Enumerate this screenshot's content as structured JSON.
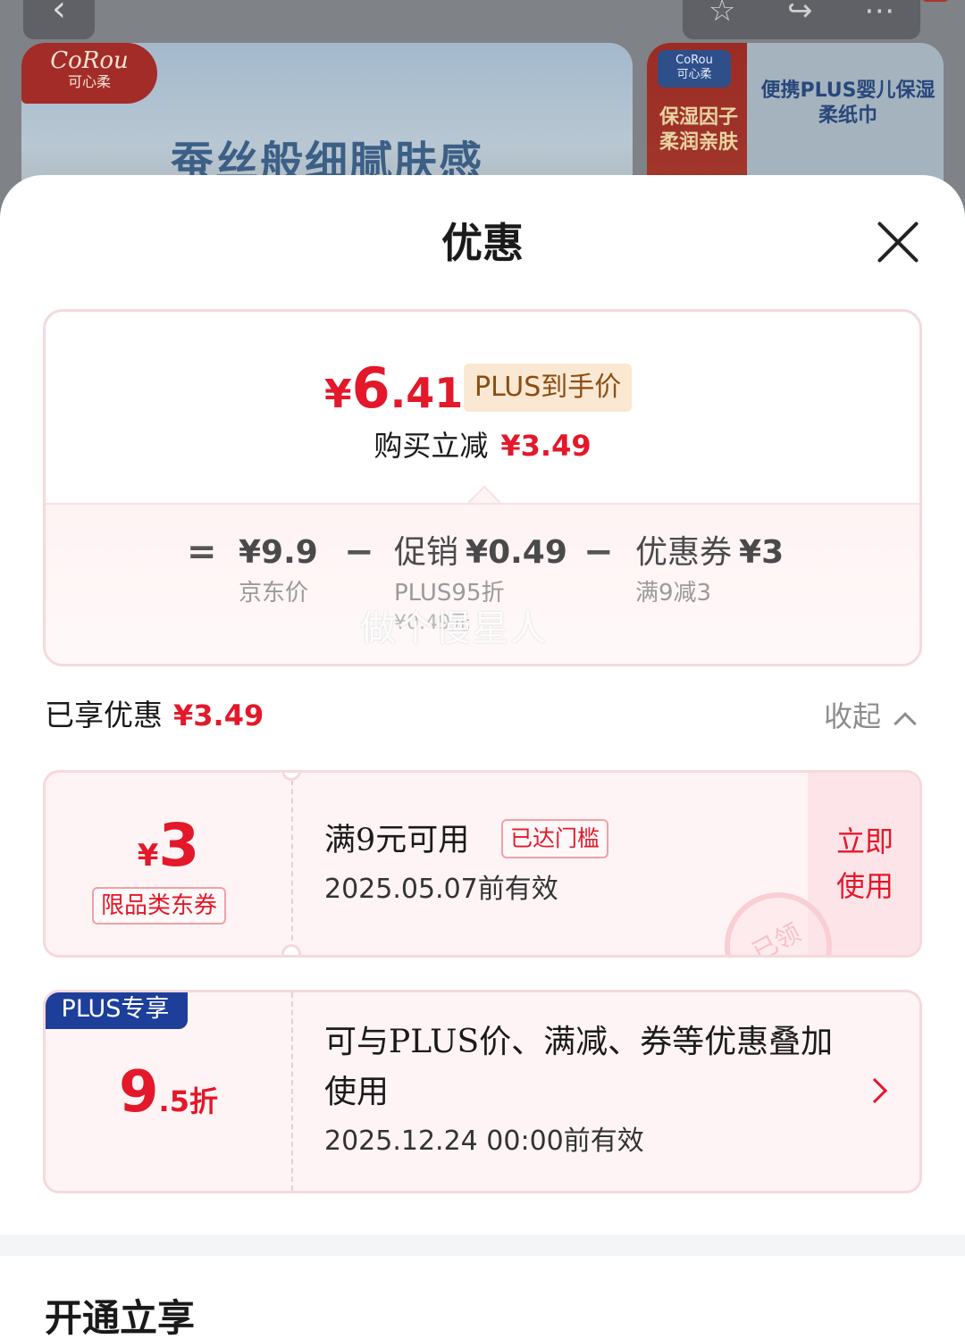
{
  "background_page": {
    "back_icon": "chevron-left-icon",
    "action_icons": [
      "star-icon",
      "share-icon",
      "more-icon"
    ],
    "banner_main": {
      "brand_logo": "CoRou",
      "brand_cn": "可心柔",
      "slogan": "蚕丝般细腻肤感"
    },
    "banner_side": {
      "logo": "CoRou",
      "logo_cn": "可心柔",
      "pack_text": "保湿因子柔润亲肤",
      "copy": "便携PLUS婴儿保湿柔纸巾"
    }
  },
  "sheet": {
    "title": "优惠",
    "close_icon": "close-icon"
  },
  "summary": {
    "currency": "¥",
    "final_int": "6",
    "final_dec": ".41",
    "price_tag": "PLUS到手价",
    "save_label": "购买立减",
    "save_amount": "¥3.49",
    "formula": {
      "eq": "=",
      "minus": "−",
      "base_value": "¥9.9",
      "base_label": "京东价",
      "promo_label": "促销",
      "promo_value": "¥0.49",
      "promo_sub": "PLUS95折",
      "promo_sub2": "¥0.49元",
      "coupon_label": "优惠券",
      "coupon_value": "¥3",
      "coupon_sub": "满9减3"
    },
    "watermark": "做个慢星人"
  },
  "enjoyed": {
    "label": "已享优惠",
    "amount": "¥3.49",
    "collapse_label": "收起"
  },
  "coupon": {
    "currency": "¥",
    "amount": "3",
    "scope": "限品类东券",
    "condition": "满9元可用",
    "status_tag": "已达门槛",
    "valid_date": "2025.05.07",
    "valid_suffix": "前有效",
    "use_line1": "立即",
    "use_line2": "使用",
    "stamp": "已领"
  },
  "plus_discount": {
    "badge": "PLUS专享",
    "rate_big": "9",
    "rate_small": ".5折",
    "description": "可与PLUS价、满减、券等优惠叠加使用",
    "valid_date": "2025.12.24 00:00",
    "valid_suffix": "前有效"
  },
  "open_section": {
    "title": "开通立享"
  },
  "colors": {
    "accent_red": "#e3182a",
    "plus_blue": "#1d3f9a",
    "card_border": "#f5d9dd",
    "card_bg": "#fff4f5"
  }
}
